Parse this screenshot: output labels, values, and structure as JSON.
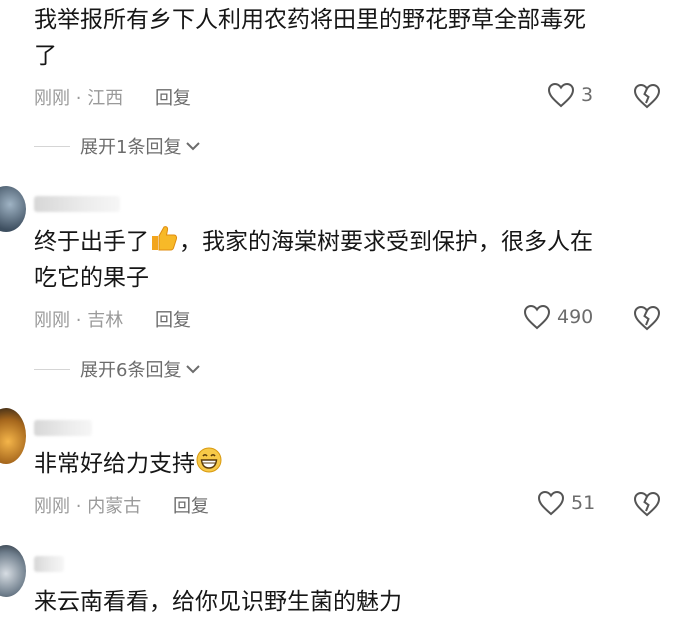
{
  "comments": [
    {
      "text_line1": "我举报所有乡下人利用农药将田里的野花野草全部毒死",
      "text_line2": "了",
      "time": "刚刚",
      "location": "江西",
      "reply_label": "回复",
      "likes": "3",
      "expand_label": "展开1条回复"
    },
    {
      "text_line1": "终于出手了",
      "text_line1_emoji": "thumbs-up",
      "text_line1_rest": "，我家的海棠树要求受到保护，很多人在",
      "text_line2": "吃它的果子",
      "time": "刚刚",
      "location": "吉林",
      "reply_label": "回复",
      "likes": "490",
      "expand_label": "展开6条回复"
    },
    {
      "text_line1": "非常好给力支持",
      "text_line1_emoji": "grinning-face",
      "time": "刚刚",
      "location": "内蒙古",
      "reply_label": "回复",
      "likes": "51"
    },
    {
      "text_line1": "来云南看看，给你见识野生菌的魅力"
    }
  ],
  "separator": "·",
  "colors": {
    "text": "#161616",
    "meta": "#9a9a9a",
    "action": "#6c6c6c"
  }
}
